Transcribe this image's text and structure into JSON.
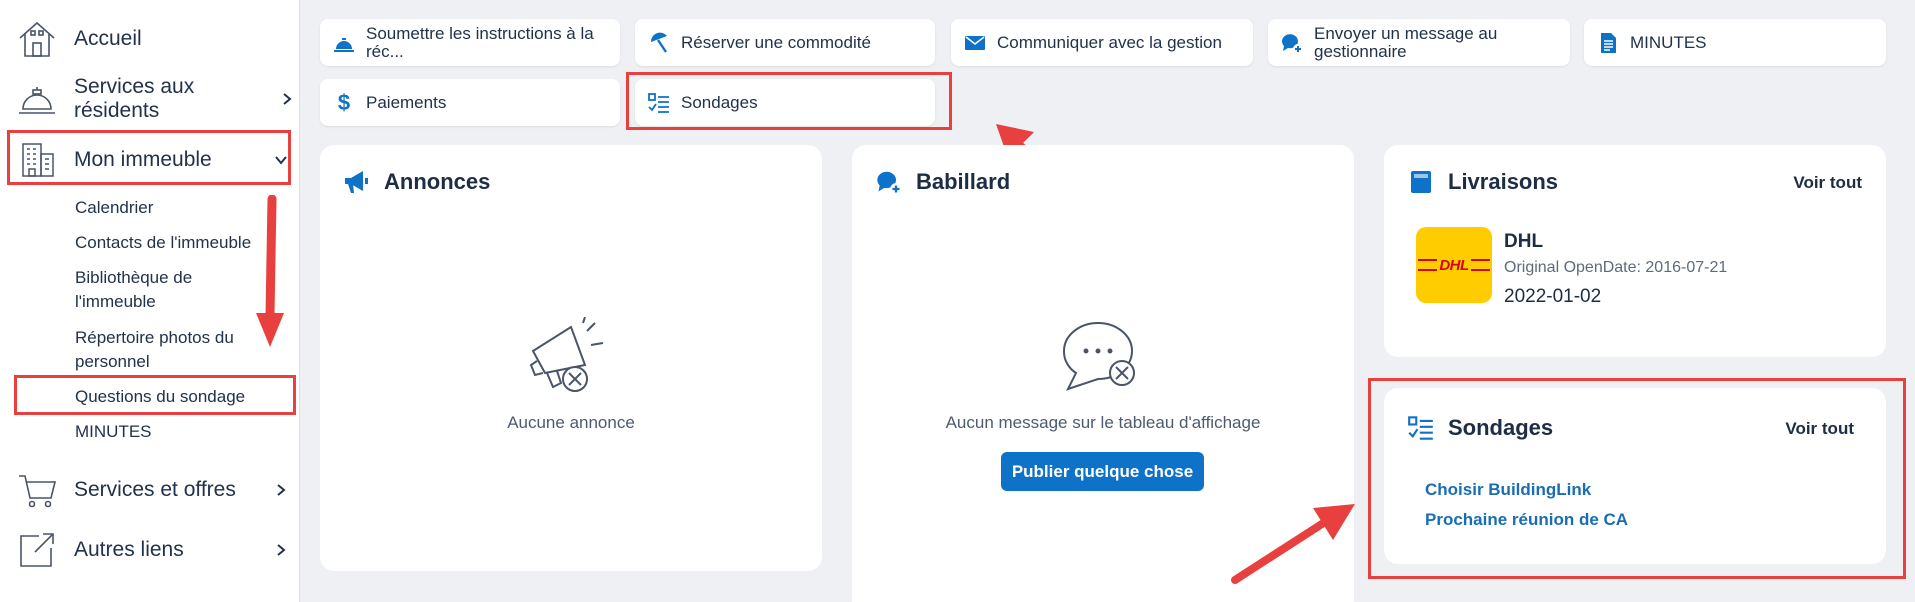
{
  "sidebar": {
    "items": [
      {
        "label": "Accueil",
        "icon": "house-icon"
      },
      {
        "label": "Services aux résidents",
        "icon": "concierge-bell-icon"
      },
      {
        "label": "Mon immeuble",
        "icon": "building-icon"
      },
      {
        "label": "Services et offres",
        "icon": "cart-icon"
      },
      {
        "label": "Autres liens",
        "icon": "external-link-icon"
      }
    ],
    "submenu": [
      "Calendrier",
      "Contacts de l'immeuble",
      "Bibliothèque de l'immeuble",
      "Répertoire photos du personnel",
      "Questions du sondage",
      "MINUTES"
    ]
  },
  "quick_actions": [
    {
      "label": "Soumettre les instructions à la réc...",
      "icon": "bell-icon"
    },
    {
      "label": "Réserver une commodité",
      "icon": "umbrella-icon"
    },
    {
      "label": "Communiquer avec la gestion",
      "icon": "envelope-icon"
    },
    {
      "label": "Envoyer un message au gestionnaire",
      "icon": "chat-plus-icon"
    },
    {
      "label": "MINUTES",
      "icon": "document-icon"
    },
    {
      "label": "Paiements",
      "icon": "dollar-icon"
    },
    {
      "label": "Sondages",
      "icon": "checklist-icon"
    }
  ],
  "annonces": {
    "title": "Annonces",
    "empty": "Aucune annonce"
  },
  "babillard": {
    "title": "Babillard",
    "empty": "Aucun message sur le tableau d'affichage",
    "button": "Publier quelque chose"
  },
  "livraisons": {
    "title": "Livraisons",
    "voir_tout": "Voir tout",
    "item": {
      "carrier": "DHL",
      "logo_text": "DHL",
      "detail": "Original OpenDate: 2016-07-21",
      "date": "2022-01-02"
    }
  },
  "sondages": {
    "title": "Sondages",
    "voir_tout": "Voir tout",
    "items": [
      "Choisir BuildingLink",
      "Prochaine réunion de CA"
    ]
  },
  "colors": {
    "accent_blue": "#0d72c8",
    "highlight_red": "#e8403f",
    "dhl_yellow": "#ffcc00",
    "dhl_red": "#d40511"
  }
}
